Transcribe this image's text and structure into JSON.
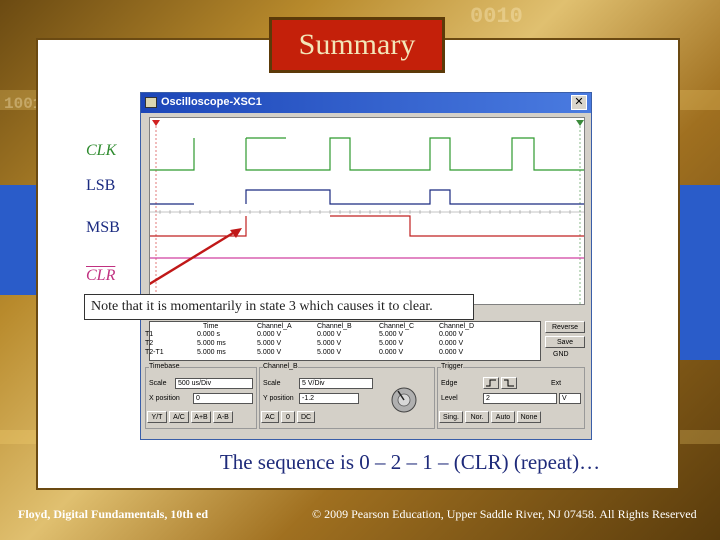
{
  "slide": {
    "title": "Summary",
    "note": "Note that it is momentarily in state 3 which causes it to clear.",
    "sequence": "The sequence is 0 – 2 – 1 – (CLR) (repeat)…",
    "footer_left": "Floyd, Digital Fundamentals, 10th ed",
    "footer_right": "© 2009 Pearson Education, Upper Saddle River, NJ 07458. All Rights Reserved"
  },
  "oscilloscope": {
    "window_title": "Oscilloscope-XSC1",
    "close_glyph": "✕",
    "signals": [
      {
        "label": "CLK",
        "color": "#2e8b2e"
      },
      {
        "label": "LSB",
        "color": "#1a2a80"
      },
      {
        "label": "MSB",
        "color": "#1a2a80"
      },
      {
        "label": "CLR",
        "color": "#c03080"
      }
    ],
    "readout": {
      "headers": [
        "Time",
        "Channel_A",
        "Channel_B",
        "Channel_C",
        "Channel_D"
      ],
      "rows": [
        [
          "T1",
          "0.000 s",
          "0.000 V",
          "0.000 V",
          "5.000 V",
          "0.000 V"
        ],
        [
          "T2",
          "5.000 ms",
          "5.000 V",
          "5.000 V",
          "5.000 V",
          "0.000 V"
        ],
        [
          "T2-T1",
          "5.000 ms",
          "5.000 V",
          "5.000 V",
          "0.000 V",
          "0.000 V"
        ]
      ],
      "reverse_label": "Reverse",
      "save_label": "Save",
      "gnd_label": "GND"
    },
    "timebase": {
      "group_label": "Timebase",
      "scale_label": "Scale",
      "scale_value": "500 us/Div",
      "xpos_label": "X position",
      "xpos_value": "0",
      "mode_buttons": [
        "Y/T",
        "A/C",
        "A+B",
        "A-B"
      ]
    },
    "channel": {
      "group_label": "Channel_B",
      "scale_label": "Scale",
      "scale_value": "5 V/Div",
      "ypos_label": "Y position",
      "ypos_value": "-1.2",
      "coupling_buttons": [
        "AC",
        "0",
        "DC"
      ]
    },
    "trigger": {
      "group_label": "Trigger",
      "edge_label": "Edge",
      "level_label": "Level",
      "level_value": "2",
      "level_unit": "V",
      "ext_label": "Ext",
      "mode_buttons": [
        "Sing.",
        "Nor.",
        "Auto",
        "None"
      ]
    }
  }
}
